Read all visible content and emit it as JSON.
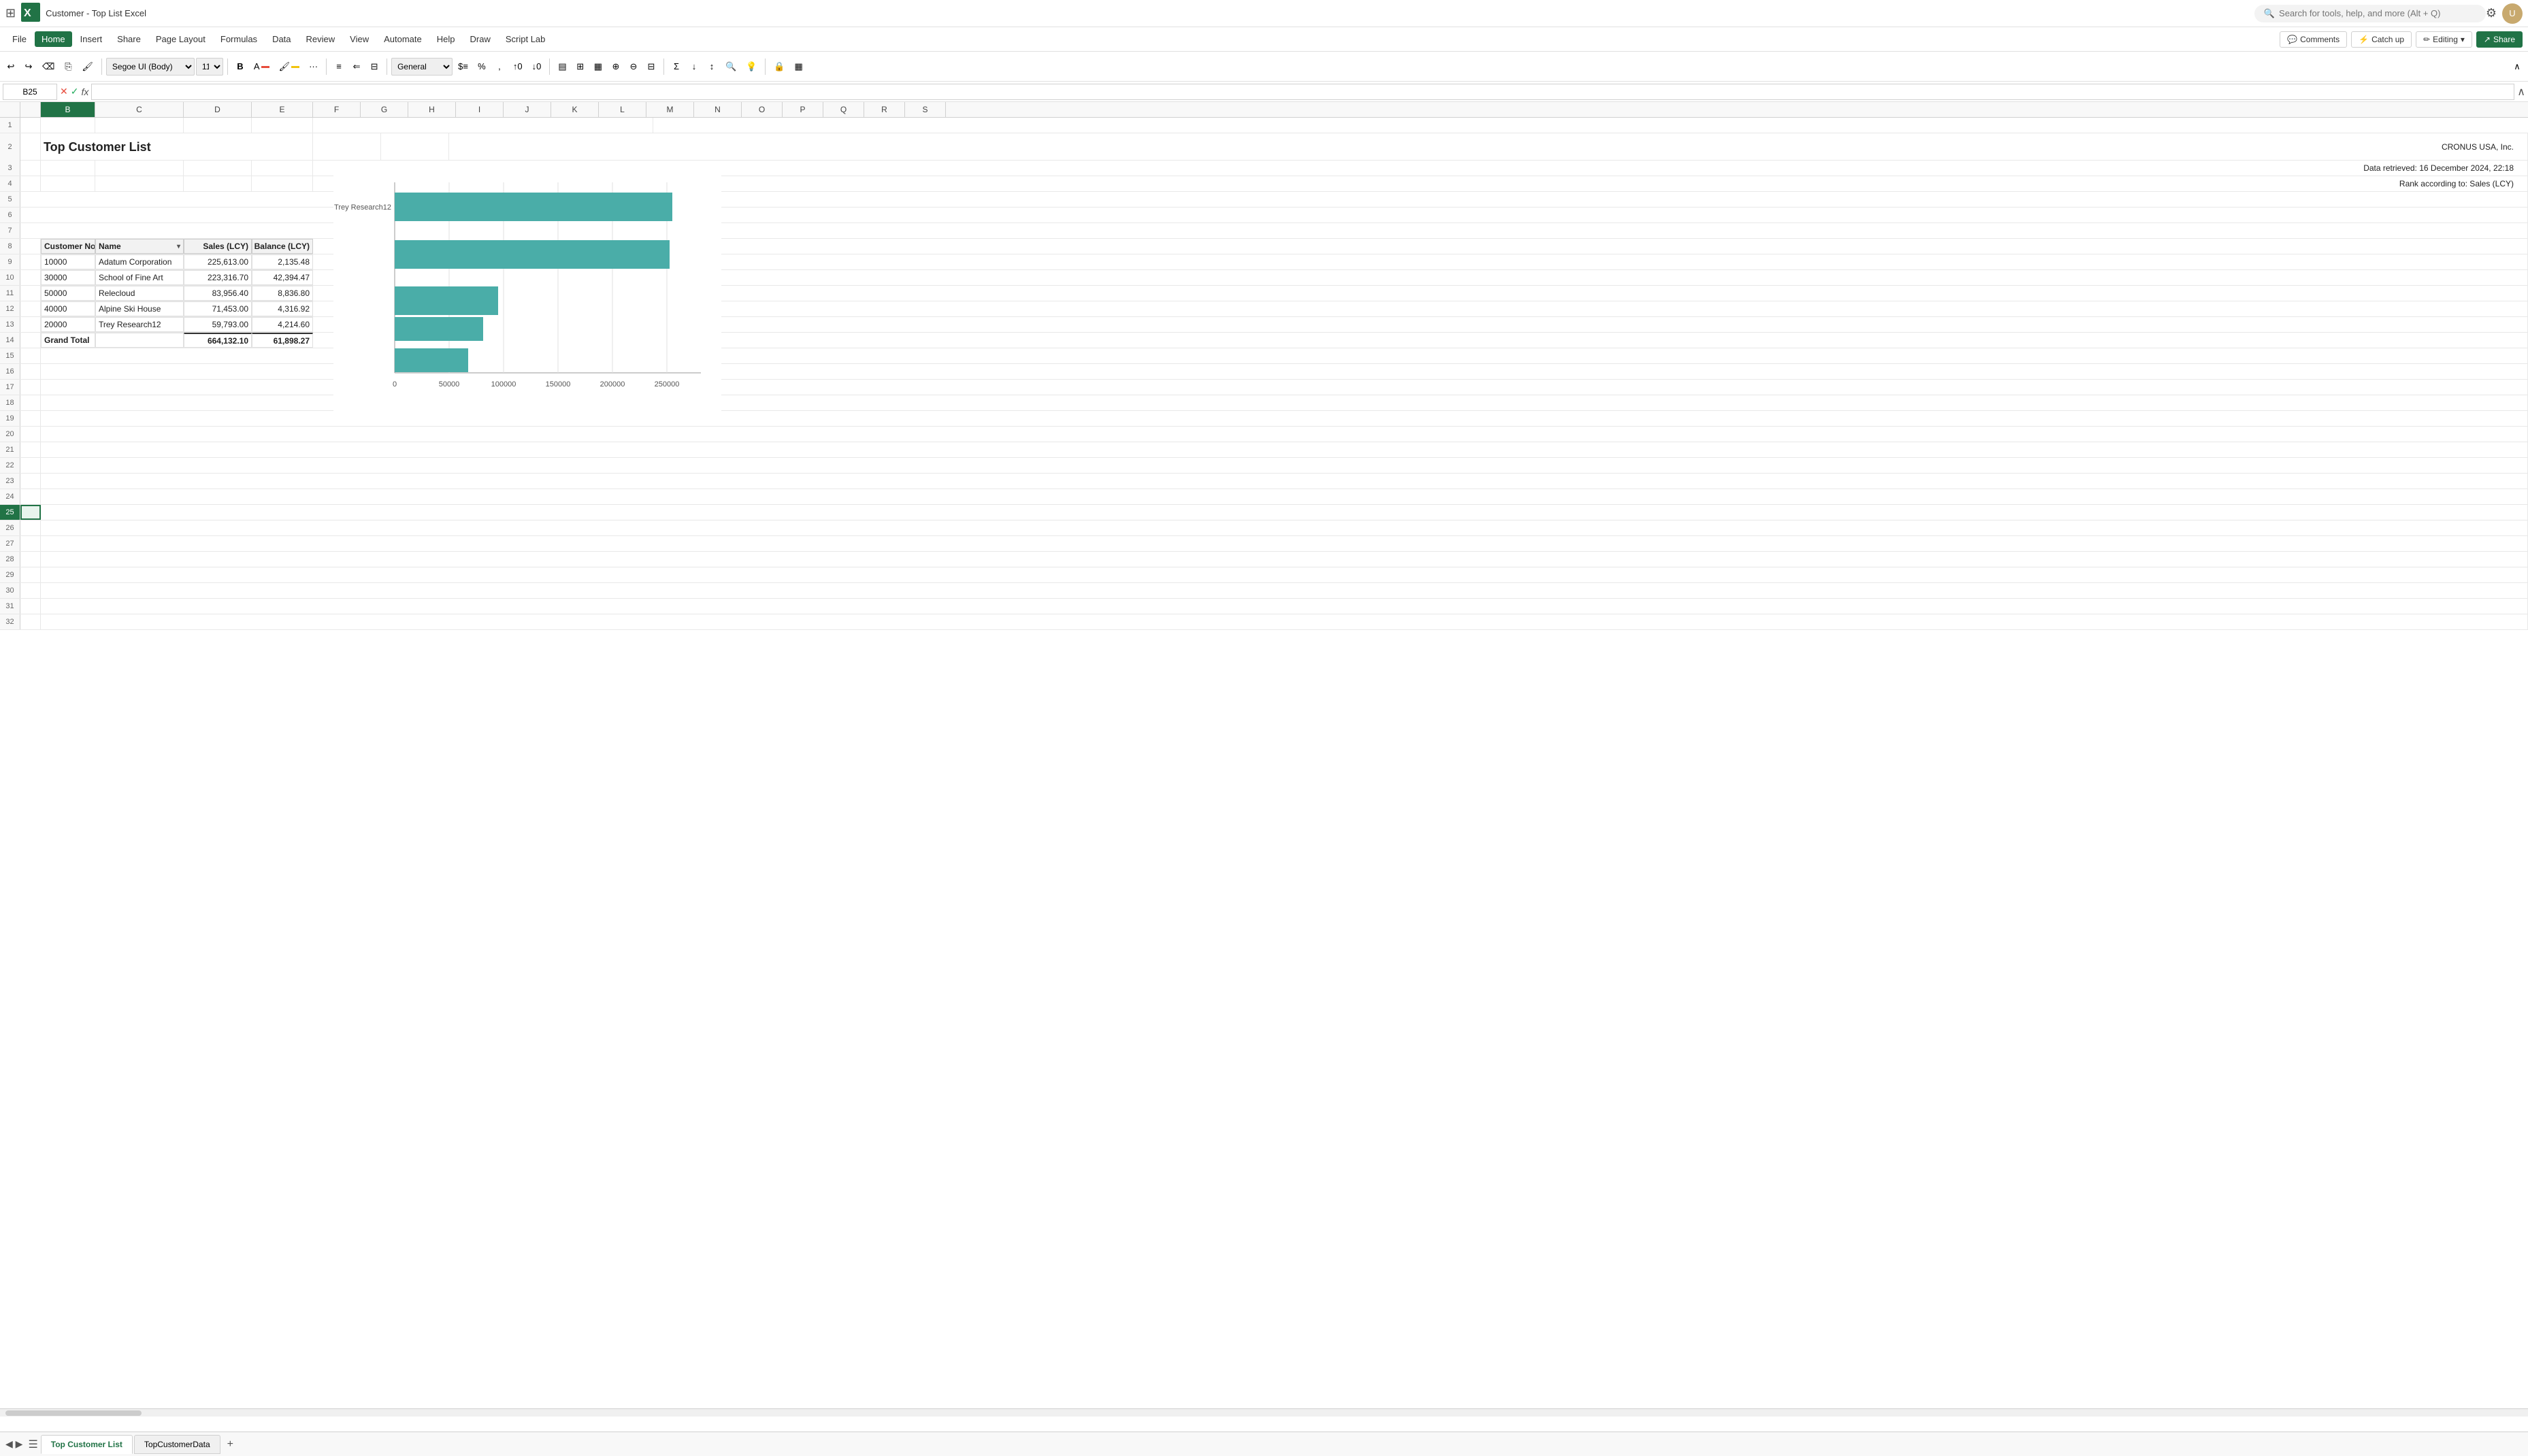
{
  "titleBar": {
    "appName": "Customer - Top List Excel",
    "searchPlaceholder": "Search for tools, help, and more (Alt + Q)"
  },
  "menuBar": {
    "items": [
      "File",
      "Home",
      "Insert",
      "Share",
      "Page Layout",
      "Formulas",
      "Data",
      "Review",
      "View",
      "Automate",
      "Help",
      "Draw",
      "Script Lab"
    ],
    "active": "Home"
  },
  "actionButtons": {
    "comments": "Comments",
    "catchUp": "Catch up",
    "editing": "Editing",
    "share": "Share"
  },
  "toolbar": {
    "fontName": "Segoe UI (Body)",
    "fontSize": "11",
    "formatType": "General"
  },
  "formulaBar": {
    "cellRef": "B25",
    "formula": ""
  },
  "spreadsheet": {
    "columns": [
      "",
      "A",
      "B",
      "C",
      "D",
      "E",
      "F",
      "G",
      "H",
      "I",
      "J",
      "K",
      "L",
      "M",
      "N",
      "O",
      "P",
      "Q",
      "R",
      "S"
    ],
    "title": "Top Customer List",
    "companyName": "CRONUS USA, Inc.",
    "dataRetrieved": "Data retrieved: 16 December 2024, 22:18",
    "rankInfo": "Rank according to: Sales (LCY)",
    "tableHeaders": {
      "customerNo": "Customer No",
      "name": "Name",
      "salesLCY": "Sales (LCY)",
      "balanceLCY": "Balance (LCY)"
    },
    "tableData": [
      {
        "row": 9,
        "no": "10000",
        "name": "Adatum Corporation",
        "sales": "225,613.00",
        "balance": "2,135.48"
      },
      {
        "row": 10,
        "no": "30000",
        "name": "School of Fine Art",
        "sales": "223,316.70",
        "balance": "42,394.47"
      },
      {
        "row": 11,
        "no": "50000",
        "name": "Relecloud",
        "sales": "83,956.40",
        "balance": "8,836.80"
      },
      {
        "row": 12,
        "no": "40000",
        "name": "Alpine Ski House",
        "sales": "71,453.00",
        "balance": "4,316.92"
      },
      {
        "row": 13,
        "no": "20000",
        "name": "Trey Research12",
        "sales": "59,793.00",
        "balance": "4,214.60"
      }
    ],
    "grandTotal": {
      "label": "Grand Total",
      "sales": "664,132.10",
      "balance": "61,898.27"
    },
    "rows": 32
  },
  "chart": {
    "bars": [
      {
        "label": "Trey Research12",
        "value": 225613
      },
      {
        "label": "",
        "value": 223316
      },
      {
        "label": "",
        "value": 83956
      },
      {
        "label": "",
        "value": 71453
      },
      {
        "label": "",
        "value": 59793
      }
    ],
    "maxValue": 250000,
    "xAxisLabels": [
      "0",
      "50000",
      "100000",
      "150000",
      "200000",
      "250000"
    ]
  },
  "sheets": {
    "tabs": [
      "Top Customer List",
      "TopCustomerData"
    ],
    "active": "Top Customer List"
  }
}
